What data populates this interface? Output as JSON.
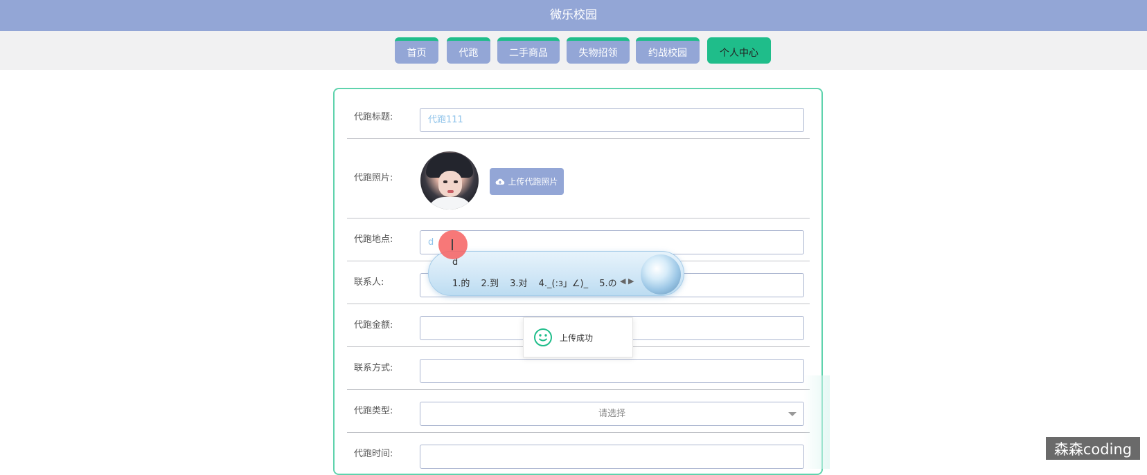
{
  "app": {
    "title": "微乐校园"
  },
  "nav": {
    "items": [
      {
        "label": "首页",
        "active": false
      },
      {
        "label": "代跑",
        "active": false
      },
      {
        "label": "二手商品",
        "active": false
      },
      {
        "label": "失物招领",
        "active": false
      },
      {
        "label": "约战校园",
        "active": false
      },
      {
        "label": "个人中心",
        "active": true
      }
    ]
  },
  "form": {
    "title_label": "代跑标题:",
    "title_value": "代跑111",
    "photo_label": "代跑照片:",
    "upload_button": "上传代跑照片",
    "location_label": "代跑地点:",
    "location_value": "d",
    "contact_person_label": "联系人:",
    "amount_label": "代跑金额:",
    "contact_method_label": "联系方式:",
    "type_label": "代跑类型:",
    "type_placeholder": "请选择",
    "time_label": "代跑时间:"
  },
  "ime": {
    "composition": "d",
    "candidates": "1.的 2.到 3.对 4._(:з」∠)_ 5.の"
  },
  "toast": {
    "message": "上传成功"
  },
  "watermark": {
    "text": "森森coding"
  },
  "colors": {
    "primary": "#93a6d6",
    "accent": "#1fbd8a",
    "border": "#5fd3ad"
  }
}
